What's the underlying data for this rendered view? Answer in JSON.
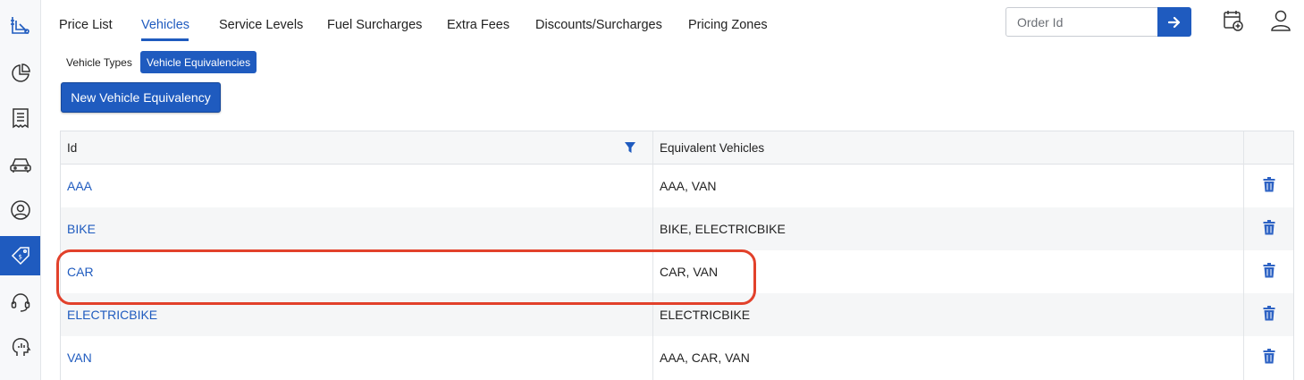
{
  "sidebar": {
    "items": [
      {
        "icon": "logo-icon"
      },
      {
        "icon": "pie-chart-icon"
      },
      {
        "icon": "receipt-icon"
      },
      {
        "icon": "car-icon"
      },
      {
        "icon": "user-circle-icon"
      },
      {
        "icon": "price-tag-icon",
        "active": true
      },
      {
        "icon": "headset-icon"
      },
      {
        "icon": "analytics-head-icon"
      }
    ],
    "accent": "#1f5bbf"
  },
  "tabs": [
    {
      "label": "Price List"
    },
    {
      "label": "Vehicles",
      "active": true
    },
    {
      "label": "Service Levels"
    },
    {
      "label": "Fuel Surcharges"
    },
    {
      "label": "Extra Fees"
    },
    {
      "label": "Discounts/Surcharges"
    },
    {
      "label": "Pricing Zones"
    }
  ],
  "search": {
    "placeholder": "Order Id",
    "value": ""
  },
  "subtabs": {
    "vehicle_types": "Vehicle Types",
    "vehicle_equivalencies": "Vehicle Equivalencies"
  },
  "actions": {
    "new_label": "New Vehicle Equivalency"
  },
  "table": {
    "headers": {
      "id": "Id",
      "equivalent": "Equivalent Vehicles"
    },
    "rows": [
      {
        "id": "AAA",
        "equivalent": "AAA, VAN"
      },
      {
        "id": "BIKE",
        "equivalent": "BIKE, ELECTRICBIKE"
      },
      {
        "id": "CAR",
        "equivalent": "CAR, VAN"
      },
      {
        "id": "ELECTRICBIKE",
        "equivalent": "ELECTRICBIKE"
      },
      {
        "id": "VAN",
        "equivalent": "AAA, CAR, VAN"
      }
    ]
  },
  "colors": {
    "accent": "#1f5bbf",
    "highlight": "#e2412b"
  }
}
